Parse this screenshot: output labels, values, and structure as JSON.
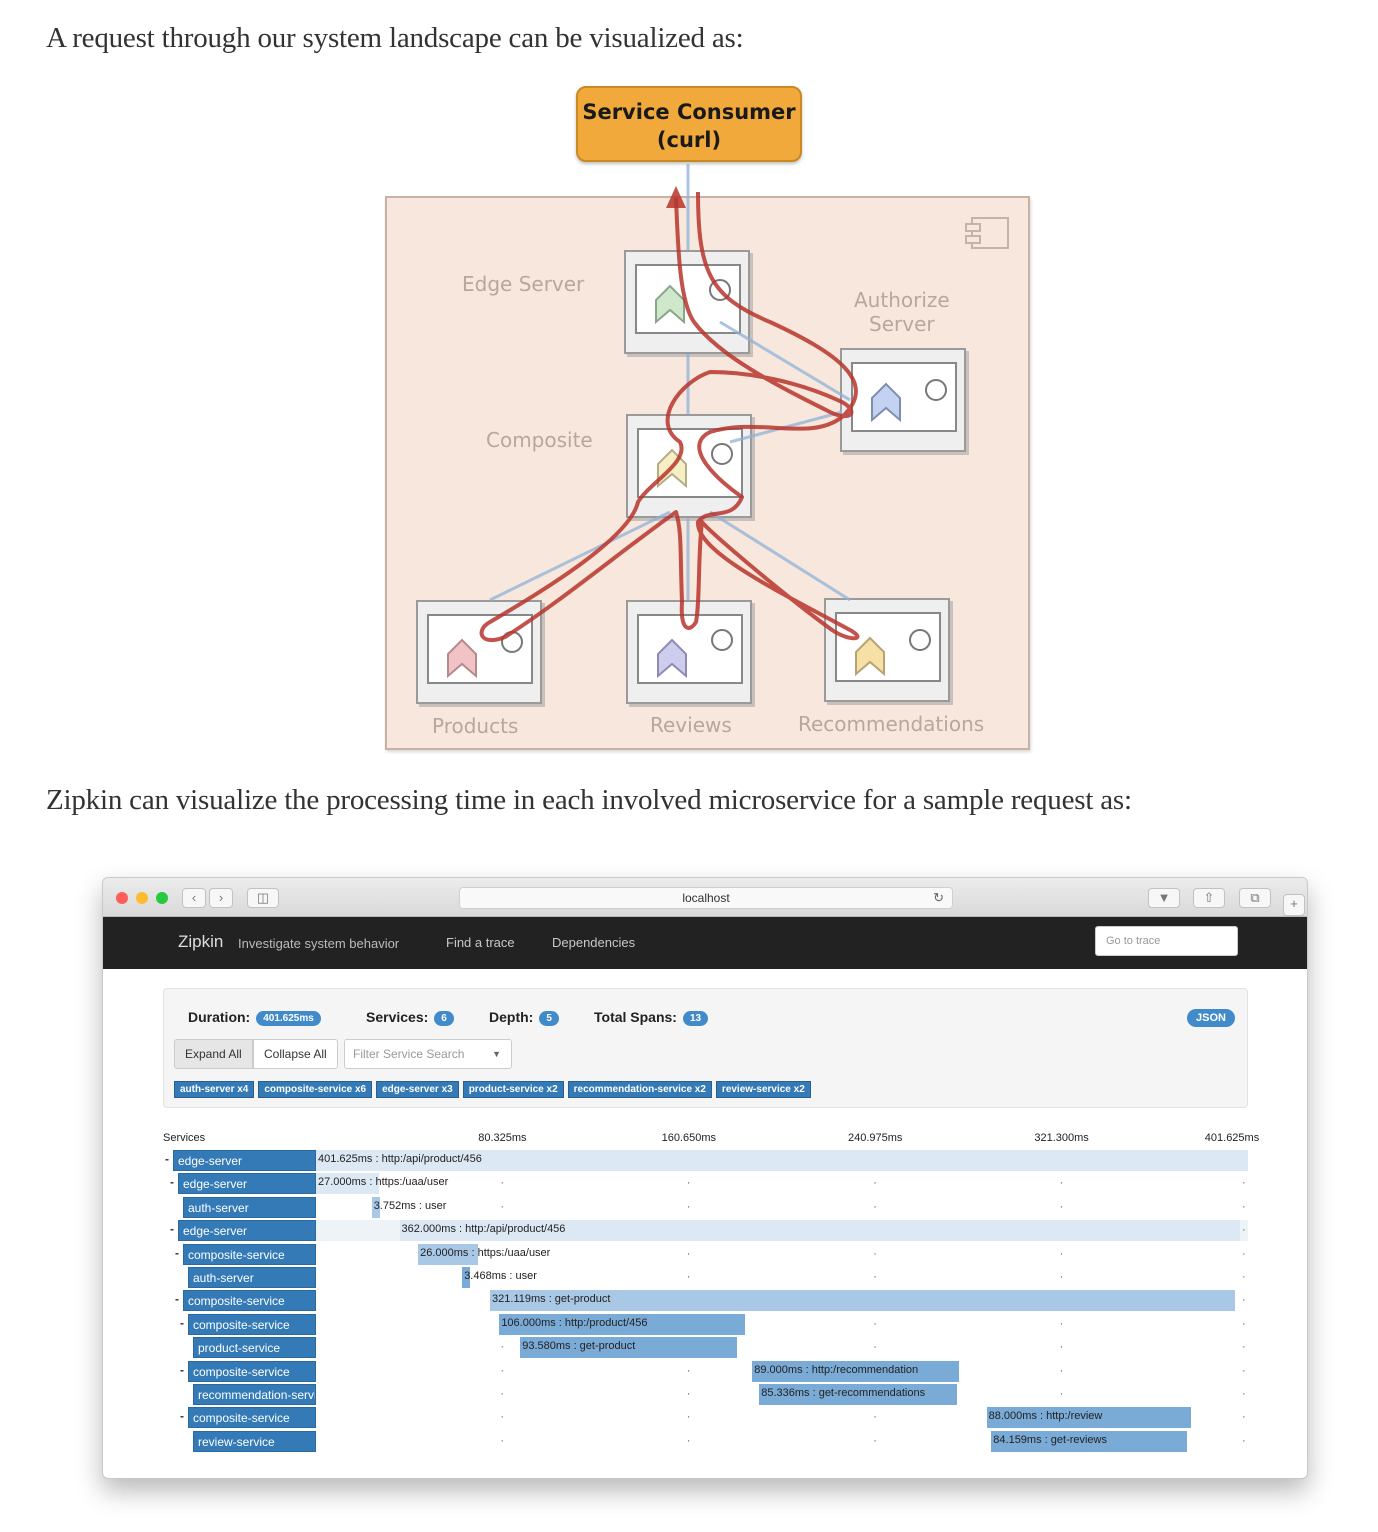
{
  "intro_text": "A request through our system landscape can be visualized as:",
  "zipkin_text": "Zipkin can visualize the processing time in each involved microservice for a sample request as:",
  "diagram": {
    "consumer_line1": "Service Consumer",
    "consumer_line2": "(curl)",
    "labels": {
      "edge": "Edge Server",
      "authorize_line1": "Authorize",
      "authorize_line2": "Server",
      "composite": "Composite",
      "products": "Products",
      "reviews": "Reviews",
      "recommendations": "Recommendations"
    },
    "colors": {
      "consumer": "#f0a93a",
      "frame": "#f7e7dc",
      "flow": "#b7342b",
      "link": "#8fb1d9"
    }
  },
  "browser": {
    "address": "localhost",
    "brand": "Zipkin",
    "tagline": "Investigate system behavior",
    "nav": [
      "Find a trace",
      "Dependencies"
    ],
    "goto_placeholder": "Go to trace",
    "summary": {
      "duration_label": "Duration:",
      "duration": "401.625ms",
      "services_label": "Services:",
      "services": "6",
      "depth_label": "Depth:",
      "depth": "5",
      "spans_label": "Total Spans:",
      "spans": "13",
      "json": "JSON"
    },
    "expand_all": "Expand All",
    "collapse_all": "Collapse All",
    "filter_placeholder": "Filter Service Search",
    "service_tags": [
      "auth-server x4",
      "composite-service x6",
      "edge-server x3",
      "product-service x2",
      "recommendation-service x2",
      "review-service x2"
    ],
    "services_header": "Services",
    "ticks": [
      "80.325ms",
      "160.650ms",
      "240.975ms",
      "321.300ms",
      "401.625ms"
    ],
    "total_ms": 401.625,
    "spans": [
      {
        "service": "edge-server",
        "depth": 0,
        "start_ms": 0,
        "duration_ms": 401.625,
        "text": "401.625ms : http:/api/product/456"
      },
      {
        "service": "edge-server",
        "depth": 1,
        "start_ms": 0,
        "duration_ms": 27.0,
        "text": "27.000ms : https:/uaa/user"
      },
      {
        "service": "auth-server",
        "depth": 2,
        "start_ms": 24.0,
        "duration_ms": 3.752,
        "text": "3.752ms : user"
      },
      {
        "service": "edge-server",
        "depth": 1,
        "start_ms": 36.0,
        "duration_ms": 362.0,
        "text": "362.000ms : http:/api/product/456"
      },
      {
        "service": "composite-service",
        "depth": 2,
        "start_ms": 44.0,
        "duration_ms": 26.0,
        "text": "26.000ms : https:/uaa/user"
      },
      {
        "service": "auth-server",
        "depth": 3,
        "start_ms": 63.0,
        "duration_ms": 3.468,
        "text": "3.468ms : user"
      },
      {
        "service": "composite-service",
        "depth": 2,
        "start_ms": 75.0,
        "duration_ms": 321.119,
        "text": "321.119ms : get-product"
      },
      {
        "service": "composite-service",
        "depth": 3,
        "start_ms": 79.0,
        "duration_ms": 106.0,
        "text": "106.000ms : http:/product/456"
      },
      {
        "service": "product-service",
        "depth": 4,
        "start_ms": 88.0,
        "duration_ms": 93.58,
        "text": "93.580ms : get-product"
      },
      {
        "service": "composite-service",
        "depth": 3,
        "start_ms": 188.0,
        "duration_ms": 89.0,
        "text": "89.000ms : http:/recommendation"
      },
      {
        "service": "recommendation-service",
        "depth": 4,
        "start_ms": 191.0,
        "duration_ms": 85.336,
        "text": "85.336ms : get-recommendations"
      },
      {
        "service": "composite-service",
        "depth": 3,
        "start_ms": 289.0,
        "duration_ms": 88.0,
        "text": "88.000ms : http:/review"
      },
      {
        "service": "review-service",
        "depth": 4,
        "start_ms": 291.0,
        "duration_ms": 84.159,
        "text": "84.159ms : get-reviews"
      }
    ],
    "colors": {
      "navbar": "#222222",
      "primary": "#337ab7",
      "bar_light": "#dce8f4",
      "bar_mid": "#a9c8e6",
      "bar_dark": "#7aaad6"
    }
  }
}
